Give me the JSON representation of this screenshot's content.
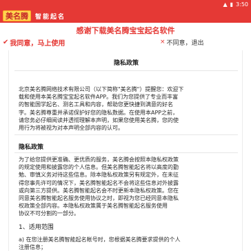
{
  "status_bar": {
    "signal_icon": "signal-icon",
    "battery_icon": "battery-icon",
    "time": "3:50"
  },
  "app_bar": {
    "logo_text": "美名腾",
    "subtitle": "智能起名"
  },
  "header_title": "感谢下载美名腾宝宝起名软件",
  "actions": {
    "agree_icon": "check-icon",
    "agree_label": "我同意，马上使用",
    "disagree_icon": "close-icon",
    "disagree_label": "不同意，退出"
  },
  "policy": {
    "title": "隐私政策",
    "intro_lines": [
      "北京美名腾网络技术有限公司（以下简称\"美名腾\"）提醒您：欢迎下",
      "载和使用本美名腾宝宝起名软件APP。我们为您提供了专业而丰富",
      "的智能国学起名、测名工具和内容，帮助您更快捷到满意的好名",
      "字。美名腾尊重并承诺保护好您的隐私数据。在使用本APP之前，",
      "请您务必仔细阅读并透彻理解本声明，如果您使用美名腾，您的使",
      "用行为将被视为对本声明全部内容的认可。"
    ],
    "section_title": "隐私政策",
    "body_lines": [
      "为了给您提供更准确、更优质的服务，美名腾会按照本隐私权政策",
      "的规定使用和披露您的个人信息。但美名腾智能起名将以高度的勤",
      "勉、审慎义务对待这些信息。除本隐私权政策另有规定外，在未征",
      "得您事先许可的情况下，美名腾智能起名不会将这些信息对外披露",
      "或向第三方提供。美名腾智能起名会不时更新本隐私权政策。您在",
      "同意美名腾智能起名服务使用协议之时，即视为您已经同意本隐私",
      "权政策全部内容。本隐私权政策属于美名腾智能起名服务使用",
      "协议不可分割的一部分。"
    ],
    "scope_title": "1、适用范围",
    "scope_lines": [
      "a) 在您注册美名腾智能起名帐号时，您根据美名腾要求提供的个人",
      "注册信息；"
    ]
  }
}
